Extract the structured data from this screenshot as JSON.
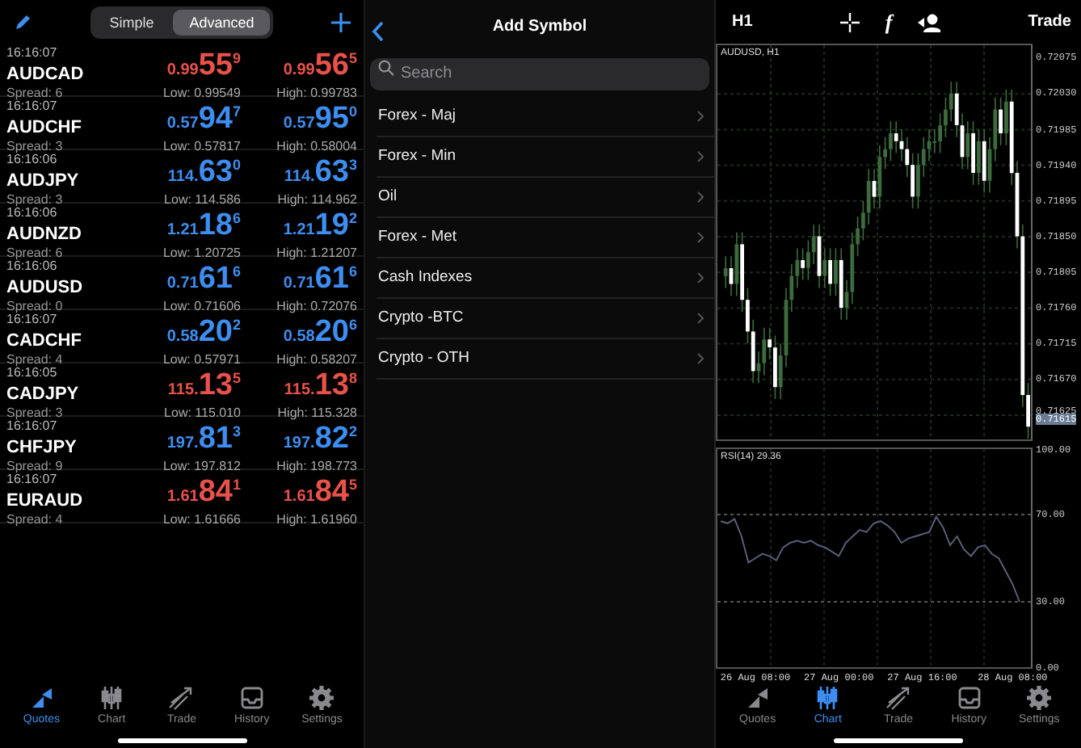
{
  "quotes_panel": {
    "segments": [
      {
        "label": "Simple",
        "selected": false
      },
      {
        "label": "Advanced",
        "selected": true
      }
    ],
    "quotes": [
      {
        "time": "16:16:07",
        "symbol": "AUDCAD",
        "spread": "Spread: 6",
        "color": "#e9524a",
        "bid": {
          "prefix": "0.99",
          "main": "55",
          "sup": "9"
        },
        "ask": {
          "prefix": "0.99",
          "main": "56",
          "sup": "5"
        },
        "low": "Low: 0.99549",
        "high": "High: 0.99783"
      },
      {
        "time": "16:16:07",
        "symbol": "AUDCHF",
        "spread": "Spread: 3",
        "color": "#3d8ef0",
        "bid": {
          "prefix": "0.57",
          "main": "94",
          "sup": "7"
        },
        "ask": {
          "prefix": "0.57",
          "main": "95",
          "sup": "0"
        },
        "low": "Low: 0.57817",
        "high": "High: 0.58004"
      },
      {
        "time": "16:16:06",
        "symbol": "AUDJPY",
        "spread": "Spread: 3",
        "color": "#3d8ef0",
        "bid": {
          "prefix": "114.",
          "main": "63",
          "sup": "0"
        },
        "ask": {
          "prefix": "114.",
          "main": "63",
          "sup": "3"
        },
        "low": "Low: 114.586",
        "high": "High: 114.962"
      },
      {
        "time": "16:16:06",
        "symbol": "AUDNZD",
        "spread": "Spread: 6",
        "color": "#3d8ef0",
        "bid": {
          "prefix": "1.21",
          "main": "18",
          "sup": "6"
        },
        "ask": {
          "prefix": "1.21",
          "main": "19",
          "sup": "2"
        },
        "low": "Low: 1.20725",
        "high": "High: 1.21207"
      },
      {
        "time": "16:16:06",
        "symbol": "AUDUSD",
        "spread": "Spread: 0",
        "color": "#3d8ef0",
        "bid": {
          "prefix": "0.71",
          "main": "61",
          "sup": "6"
        },
        "ask": {
          "prefix": "0.71",
          "main": "61",
          "sup": "6"
        },
        "low": "Low: 0.71606",
        "high": "High: 0.72076"
      },
      {
        "time": "16:16:07",
        "symbol": "CADCHF",
        "spread": "Spread: 4",
        "color": "#3d8ef0",
        "bid": {
          "prefix": "0.58",
          "main": "20",
          "sup": "2"
        },
        "ask": {
          "prefix": "0.58",
          "main": "20",
          "sup": "6"
        },
        "low": "Low: 0.57971",
        "high": "High: 0.58207"
      },
      {
        "time": "16:16:05",
        "symbol": "CADJPY",
        "spread": "Spread: 3",
        "color": "#e9524a",
        "bid": {
          "prefix": "115.",
          "main": "13",
          "sup": "5"
        },
        "ask": {
          "prefix": "115.",
          "main": "13",
          "sup": "8"
        },
        "low": "Low: 115.010",
        "high": "High: 115.328"
      },
      {
        "time": "16:16:07",
        "symbol": "CHFJPY",
        "spread": "Spread: 9",
        "color": "#3d8ef0",
        "bid": {
          "prefix": "197.",
          "main": "81",
          "sup": "3"
        },
        "ask": {
          "prefix": "197.",
          "main": "82",
          "sup": "2"
        },
        "low": "Low: 197.812",
        "high": "High: 198.773"
      },
      {
        "time": "16:16:07",
        "symbol": "EURAUD",
        "spread": "Spread: 4",
        "color": "#e9524a",
        "bid": {
          "prefix": "1.61",
          "main": "84",
          "sup": "1"
        },
        "ask": {
          "prefix": "1.61",
          "main": "84",
          "sup": "5"
        },
        "low": "Low: 1.61666",
        "high": "High: 1.61960"
      }
    ],
    "tab_bar": [
      {
        "label": "Quotes",
        "selected": true
      },
      {
        "label": "Chart",
        "selected": false
      },
      {
        "label": "Trade",
        "selected": false
      },
      {
        "label": "History",
        "selected": false
      },
      {
        "label": "Settings",
        "selected": false
      }
    ]
  },
  "symbol_panel": {
    "title": "Add Symbol",
    "search": {
      "placeholder": "Search"
    },
    "groups": [
      "Forex - Maj",
      "Forex - Min",
      "Oil",
      "Forex - Met",
      "Cash Indexes",
      "Crypto -BTC",
      "Crypto - OTH"
    ]
  },
  "chart_panel": {
    "timeframe": "H1",
    "f_label": "f",
    "trade_label": "Trade",
    "main_chart": {
      "chart_data": {
        "type": "candlestick",
        "title": "AUDUSD, H1",
        "ylim": [
          0.71594,
          0.72091
        ],
        "grid": true,
        "categories": [
          null,
          null,
          null,
          null,
          null,
          null,
          null,
          null,
          null,
          null,
          null,
          null,
          null,
          null,
          null,
          null,
          null,
          null,
          null,
          null,
          null,
          null,
          null,
          null,
          null,
          null,
          null,
          null,
          null,
          null,
          null,
          null,
          null,
          null,
          null,
          null,
          null,
          null,
          null,
          null,
          null,
          null,
          null,
          null,
          null,
          null,
          null,
          null,
          null,
          null,
          null,
          null,
          null,
          null,
          null,
          null
        ],
        "yticks": [
          {
            "value": 0.72075,
            "label": "0.72075"
          },
          {
            "value": 0.7203,
            "label": "0.72030"
          },
          {
            "value": 0.71985,
            "label": "0.71985"
          },
          {
            "value": 0.7194,
            "label": "0.71940"
          },
          {
            "value": 0.71895,
            "label": "0.71895"
          },
          {
            "value": 0.7185,
            "label": "0.71850"
          },
          {
            "value": 0.71805,
            "label": "0.71805"
          },
          {
            "value": 0.7176,
            "label": "0.71760"
          },
          {
            "value": 0.71715,
            "label": "0.71715"
          },
          {
            "value": 0.7167,
            "label": "0.71670"
          },
          {
            "value": 0.71625,
            "label": "0.71625"
          }
        ],
        "ohlc": [
          [
            0.718,
            0.71825,
            0.71785,
            0.7181
          ],
          [
            0.7181,
            0.71825,
            0.71775,
            0.7179
          ],
          [
            0.7179,
            0.71855,
            0.71775,
            0.7184
          ],
          [
            0.7184,
            0.71855,
            0.71755,
            0.7177
          ],
          [
            0.7177,
            0.71785,
            0.71715,
            0.7173
          ],
          [
            0.7173,
            0.71745,
            0.71665,
            0.7168
          ],
          [
            0.7168,
            0.71705,
            0.71665,
            0.7169
          ],
          [
            0.7169,
            0.71735,
            0.71675,
            0.7172
          ],
          [
            0.7172,
            0.71735,
            0.71695,
            0.7171
          ],
          [
            0.7171,
            0.71725,
            0.71645,
            0.7166
          ],
          [
            0.7166,
            0.71715,
            0.71645,
            0.717
          ],
          [
            0.717,
            0.71785,
            0.71685,
            0.7177
          ],
          [
            0.7177,
            0.71815,
            0.71755,
            0.718
          ],
          [
            0.718,
            0.71835,
            0.71785,
            0.7182
          ],
          [
            0.7182,
            0.71835,
            0.71795,
            0.7181
          ],
          [
            0.7181,
            0.71845,
            0.71795,
            0.7183
          ],
          [
            0.7183,
            0.71865,
            0.71815,
            0.7185
          ],
          [
            0.7185,
            0.71865,
            0.71785,
            0.718
          ],
          [
            0.718,
            0.71835,
            0.71785,
            0.7182
          ],
          [
            0.7182,
            0.71835,
            0.71775,
            0.7179
          ],
          [
            0.7179,
            0.71835,
            0.71775,
            0.7182
          ],
          [
            0.7182,
            0.71835,
            0.71745,
            0.7176
          ],
          [
            0.7176,
            0.71795,
            0.71745,
            0.7178
          ],
          [
            0.7178,
            0.71855,
            0.71765,
            0.7184
          ],
          [
            0.7184,
            0.71875,
            0.71825,
            0.7186
          ],
          [
            0.7186,
            0.71895,
            0.71845,
            0.7188
          ],
          [
            0.7188,
            0.71935,
            0.71865,
            0.7192
          ],
          [
            0.7192,
            0.71935,
            0.71885,
            0.719
          ],
          [
            0.719,
            0.71965,
            0.71885,
            0.7195
          ],
          [
            0.7195,
            0.71975,
            0.71935,
            0.7196
          ],
          [
            0.7196,
            0.71995,
            0.71945,
            0.7198
          ],
          [
            0.7198,
            0.71995,
            0.71955,
            0.7197
          ],
          [
            0.7197,
            0.71985,
            0.71945,
            0.7196
          ],
          [
            0.7196,
            0.71975,
            0.71925,
            0.7194
          ],
          [
            0.7194,
            0.71955,
            0.71885,
            0.719
          ],
          [
            0.719,
            0.71955,
            0.71885,
            0.7194
          ],
          [
            0.7194,
            0.71975,
            0.71925,
            0.7196
          ],
          [
            0.7196,
            0.71985,
            0.71945,
            0.7197
          ],
          [
            0.7197,
            0.71985,
            0.71955,
            0.7197
          ],
          [
            0.7197,
            0.72005,
            0.71955,
            0.7199
          ],
          [
            0.7199,
            0.72025,
            0.71975,
            0.7201
          ],
          [
            0.7201,
            0.72045,
            0.71995,
            0.7203
          ],
          [
            0.7203,
            0.72045,
            0.71975,
            0.7199
          ],
          [
            0.7199,
            0.72005,
            0.71935,
            0.7195
          ],
          [
            0.7195,
            0.71995,
            0.71935,
            0.7198
          ],
          [
            0.7198,
            0.71995,
            0.71915,
            0.7193
          ],
          [
            0.7193,
            0.71985,
            0.71915,
            0.7197
          ],
          [
            0.7197,
            0.71985,
            0.71905,
            0.7192
          ],
          [
            0.7192,
            0.71975,
            0.71905,
            0.7196
          ],
          [
            0.7196,
            0.72025,
            0.71945,
            0.7201
          ],
          [
            0.7201,
            0.72025,
            0.71965,
            0.7198
          ],
          [
            0.7198,
            0.72035,
            0.71965,
            0.7202
          ],
          [
            0.7202,
            0.72035,
            0.71915,
            0.7193
          ],
          [
            0.7193,
            0.71945,
            0.71835,
            0.7185
          ],
          [
            0.7185,
            0.71865,
            0.71635,
            0.7165
          ],
          [
            0.7165,
            0.71665,
            0.71595,
            0.7161
          ]
        ]
      }
    },
    "current_price": "0.71615",
    "rsi_chart": {
      "chart_data": {
        "type": "line",
        "title": "RSI(14) 29.36",
        "ylim": [
          0,
          100
        ],
        "grid": true,
        "yticks": [
          {
            "value": 100,
            "label": "100.00"
          },
          {
            "value": 70,
            "label": "70.00"
          },
          {
            "value": 30,
            "label": "30.00"
          },
          {
            "value": 0,
            "label": "0.00"
          }
        ],
        "categories": [
          null,
          null,
          null,
          null,
          null,
          "26 Aug 08:00",
          null,
          null,
          null,
          null,
          null,
          null,
          null,
          null,
          null,
          null,
          null,
          "27 Aug 00:00",
          null,
          null,
          null,
          null,
          null,
          null,
          null,
          null,
          null,
          null,
          null,
          "27 Aug 16:00",
          null,
          null,
          null,
          null,
          null,
          null,
          null,
          null,
          null,
          null,
          null,
          null,
          "28 Aug 08:00",
          null
        ],
        "series": [
          {
            "color": "#5a5f78",
            "values": [
              67,
              66,
              68,
              60,
              48,
              50,
              52,
              51,
              49,
              55,
              57,
              58,
              57,
              58,
              56,
              55,
              53,
              51,
              57,
              60,
              63,
              62,
              66,
              67,
              65,
              62,
              57,
              59,
              60,
              61,
              62,
              69,
              64,
              56,
              60,
              54,
              51,
              55,
              56,
              52,
              50,
              44,
              38,
              30
            ]
          }
        ]
      }
    },
    "tab_bar": [
      {
        "label": "Quotes",
        "selected": false
      },
      {
        "label": "Chart",
        "selected": true
      },
      {
        "label": "Trade",
        "selected": false
      },
      {
        "label": "History",
        "selected": false
      },
      {
        "label": "Settings",
        "selected": false
      }
    ]
  }
}
